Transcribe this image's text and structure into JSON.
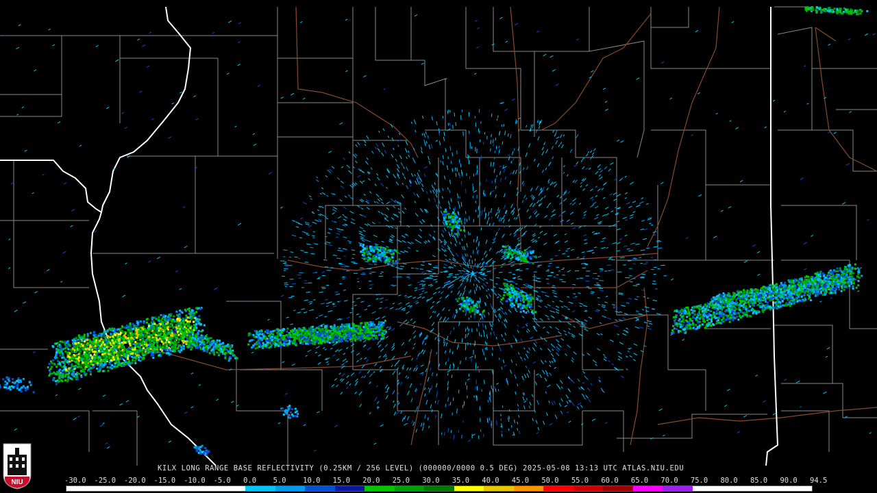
{
  "caption": "KILX LONG RANGE BASE REFLECTIVITY (0.25KM / 256 LEVEL) (000000/0000 0.5 DEG) 2025-05-08 13:13 UTC  ATLAS.NIU.EDU",
  "logo_text": "NIU",
  "scale": {
    "labels": [
      "-30.0",
      "-25.0",
      "-20.0",
      "-15.0",
      "-10.0",
      "-5.0",
      "0.0",
      "5.0",
      "10.0",
      "15.0",
      "20.0",
      "25.0",
      "30.0",
      "35.0",
      "40.0",
      "45.0",
      "50.0",
      "55.0",
      "60.0",
      "65.0",
      "70.0",
      "75.0",
      "80.0",
      "85.0",
      "90.0",
      "94.5"
    ],
    "colors": [
      "#ffffff",
      "#ffffff",
      "#ffffff",
      "#ffffff",
      "#ffffff",
      "#ffffff",
      "#00c8ff",
      "#009cf0",
      "#0050d8",
      "#0a18a0",
      "#00c800",
      "#00a000",
      "#007800",
      "#ffff00",
      "#e8c800",
      "#ff9600",
      "#ff0000",
      "#d00000",
      "#a00000",
      "#ff00ff",
      "#a020f0",
      "#ffffff",
      "#ffffff",
      "#ffffff",
      "#ffffff"
    ]
  },
  "colors": {
    "background": "#000000",
    "county_lines": "#8a8a8a",
    "state_lines": "#ffffff",
    "roads": "#8b4a2a"
  },
  "radar_site": "KILX"
}
